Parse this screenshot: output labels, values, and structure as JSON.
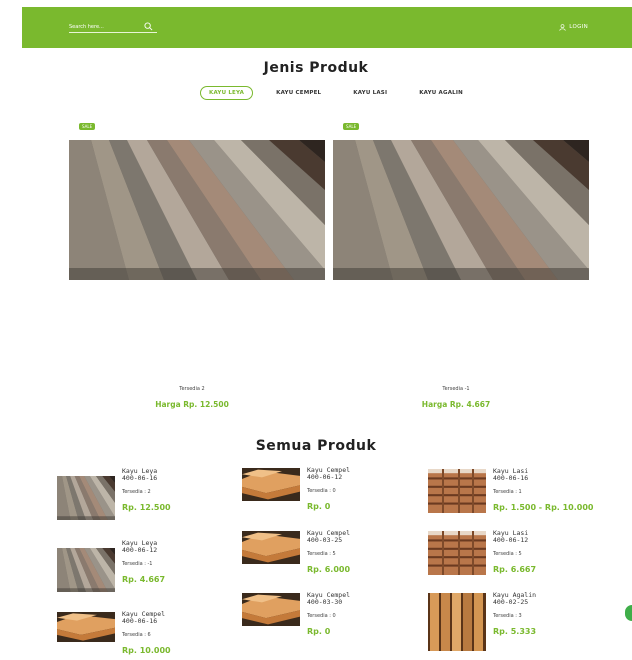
{
  "header": {
    "search_placeholder": "Search here...",
    "login_label": "LOGIN"
  },
  "jenis": {
    "title": "Jenis Produk",
    "tabs": [
      {
        "label": "KAYU LEYA",
        "active": true
      },
      {
        "label": "KAYU CEMPEL",
        "active": false
      },
      {
        "label": "KAYU LASI",
        "active": false
      },
      {
        "label": "KAYU AGALIN",
        "active": false
      }
    ],
    "cards": [
      {
        "badge": "SALE",
        "stock": "Tersedia 2",
        "price": "Harga Rp. 12.500"
      },
      {
        "badge": "SALE",
        "stock": "Tersedia -1",
        "price": "Harga Rp. 4.667"
      }
    ]
  },
  "semua": {
    "title": "Semua Produk",
    "items": [
      {
        "name": "Kayu Leya",
        "date": "400-06-16",
        "stock": "Tersedia : 2",
        "price": "Rp. 12.500",
        "image": "grey-planks"
      },
      {
        "name": "Kayu Leya",
        "date": "400-06-12",
        "stock": "Tersedia : -1",
        "price": "Rp. 4.667",
        "image": "grey-planks"
      },
      {
        "name": "Kayu Cempel",
        "date": "400-06-16",
        "stock": "Tersedia : 6",
        "price": "Rp. 10.000",
        "image": "orange-beams"
      },
      {
        "name": "Kayu Cempel",
        "date": "400-06-12",
        "stock": "Tersedia : 0",
        "price": "Rp. 0",
        "image": "orange-beams"
      },
      {
        "name": "Kayu Cempel",
        "date": "400-03-25",
        "stock": "Tersedia : 5",
        "price": "Rp. 6.000",
        "image": "orange-beams"
      },
      {
        "name": "Kayu Cempel",
        "date": "400-03-30",
        "stock": "Tersedia : 0",
        "price": "Rp. 0",
        "image": "orange-beams"
      },
      {
        "name": "Kayu Lasi",
        "date": "400-06-16",
        "stock": "Tersedia : 1",
        "price": "Rp. 1.500 - Rp. 10.000",
        "image": "stacked-lumber"
      },
      {
        "name": "Kayu Lasi",
        "date": "400-06-12",
        "stock": "Tersedia : 5",
        "price": "Rp. 6.667",
        "image": "stacked-lumber"
      },
      {
        "name": "Kayu Agalin",
        "date": "400-02-25",
        "stock": "Tersedia : 3",
        "price": "Rp. 5.333",
        "image": "upright-boards"
      }
    ]
  },
  "colors": {
    "brand": "#7ab92e",
    "fab": "#3fae49"
  }
}
